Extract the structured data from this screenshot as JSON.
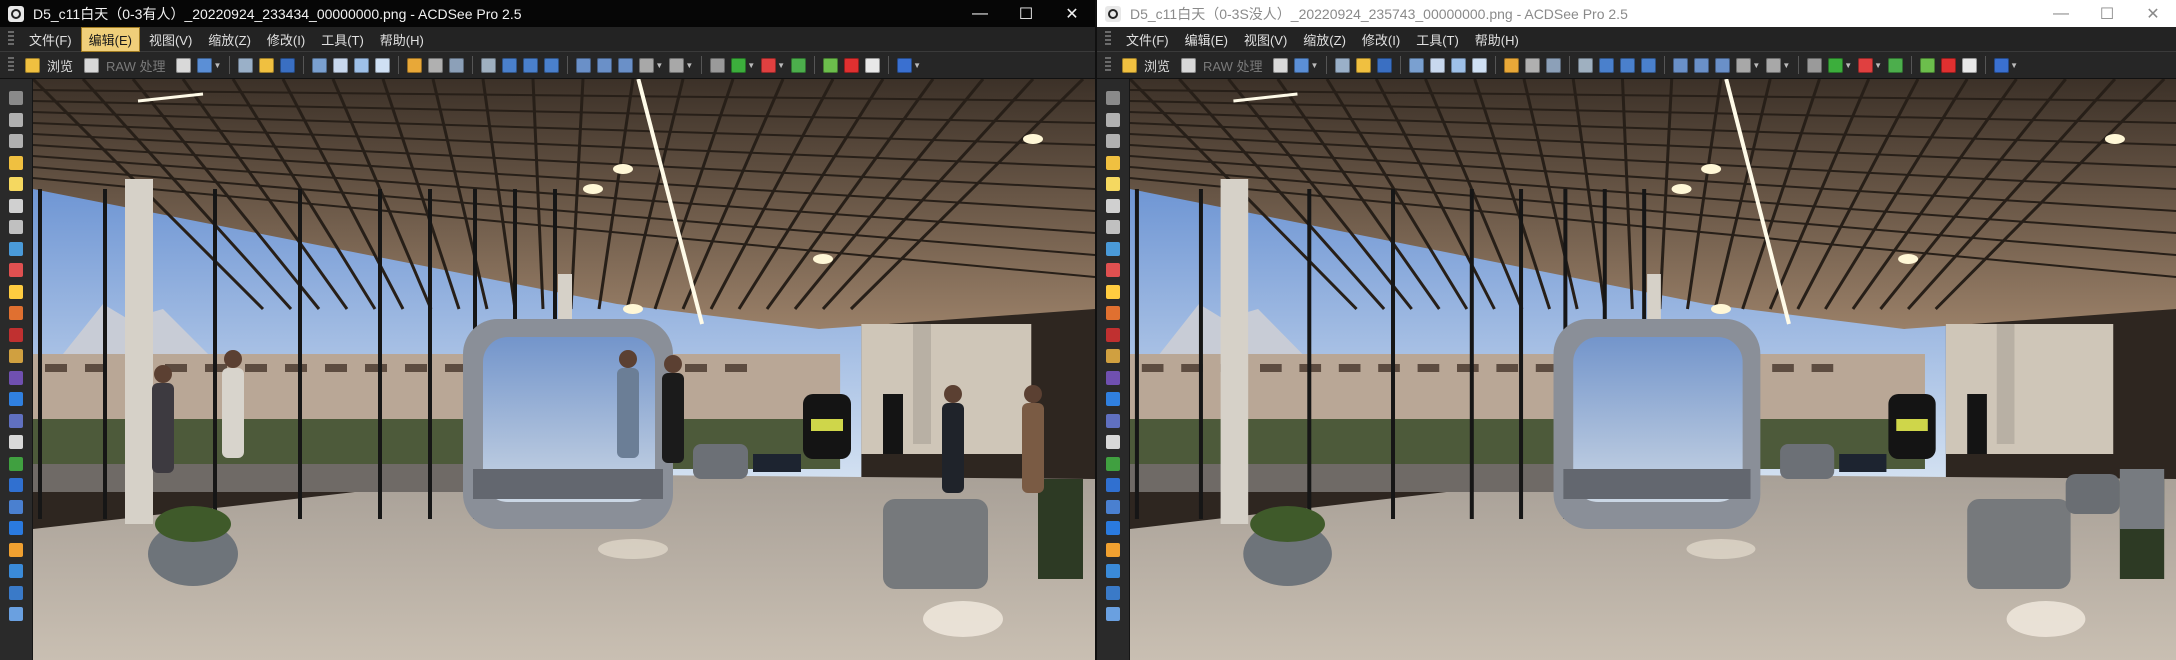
{
  "left": {
    "title": "D5_c11白天（0-3有人）_20220924_233434_00000000.png - ACDSee Pro 2.5",
    "controls": {
      "minimize": "—",
      "maximize": "☐",
      "close": "✕"
    },
    "menu": [
      "文件(F)",
      "编辑(E)",
      "视图(V)",
      "缩放(Z)",
      "修改(I)",
      "工具(T)",
      "帮助(H)"
    ],
    "active_menu_index": 1,
    "toolbar": {
      "browse_label": "浏览",
      "raw_label": "RAW 处理"
    }
  },
  "right": {
    "title": "D5_c11白天（0-3S没人）_20220924_235743_00000000.png - ACDSee Pro 2.5",
    "controls": {
      "minimize": "—",
      "maximize": "☐",
      "close": "✕"
    },
    "menu": [
      "文件(F)",
      "编辑(E)",
      "视图(V)",
      "缩放(Z)",
      "修改(I)",
      "工具(T)",
      "帮助(H)"
    ],
    "active_menu_index": -1,
    "toolbar": {
      "browse_label": "浏览",
      "raw_label": "RAW 处理"
    }
  },
  "toolbar_icons": [
    "raw-icon",
    "open-icon",
    "dropdown-icon",
    "folder-icon",
    "save-icon",
    "photo-icon",
    "photo-icon",
    "photo-icon",
    "slideshow-icon",
    "highlight-icon",
    "select-icon",
    "crop-icon",
    "arrow-icon",
    "fit-icon",
    "fit-icon",
    "fit-icon",
    "zoom-in-icon",
    "zoom-out-icon",
    "zoom-icon",
    "pan-icon",
    "pan-icon",
    "info-icon",
    "prev-icon",
    "next-icon",
    "go-icon",
    "refresh-icon",
    "delete-icon",
    "properties-icon",
    "help-icon"
  ],
  "side_tools": [
    "grip-icon",
    "rotate-left-icon",
    "rotate-right-icon",
    "red-eye-icon",
    "light-icon",
    "contrast-icon",
    "levels-icon",
    "color-icon",
    "sharpen-icon",
    "noise-icon",
    "effects-icon",
    "eye-icon",
    "tone-icon",
    "crop-icon",
    "resize-icon",
    "flip-icon",
    "text-icon",
    "border-icon",
    "vignette-icon",
    "brush-icon",
    "clone-icon",
    "blur-icon",
    "fill-icon",
    "frame-icon",
    "layers-icon"
  ],
  "colors": {
    "highlight_menu": "#f0cf7a",
    "title_active": "#060606",
    "title_inactive": "#ffffff",
    "chrome": "#2a2a2a"
  }
}
